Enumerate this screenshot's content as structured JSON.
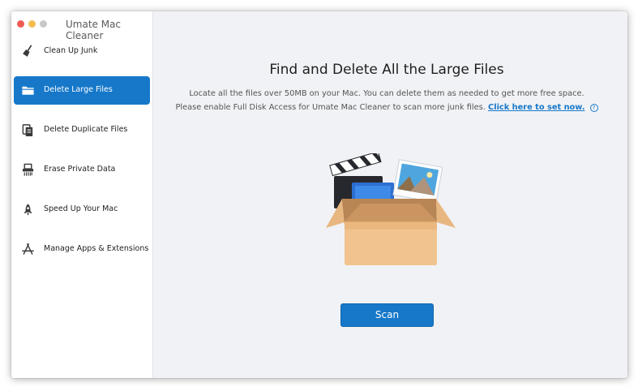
{
  "app": {
    "title": "Umate Mac Cleaner"
  },
  "sidebar": {
    "items": [
      {
        "label": "Clean Up Junk",
        "icon": "broom-icon",
        "active": false
      },
      {
        "label": "Delete Large Files",
        "icon": "folder-icon",
        "active": true
      },
      {
        "label": "Delete Duplicate Files",
        "icon": "duplicate-files-icon",
        "active": false
      },
      {
        "label": "Erase Private Data",
        "icon": "shredder-icon",
        "active": false
      },
      {
        "label": "Speed Up Your Mac",
        "icon": "rocket-icon",
        "active": false
      },
      {
        "label": "Manage Apps & Extensions",
        "icon": "app-store-icon",
        "active": false
      }
    ]
  },
  "main": {
    "title": "Find and Delete All the Large Files",
    "description_line1": "Locate all the files over 50MB on your Mac. You can delete them as needed to get more free space.",
    "description_line2": "Please enable Full Disk Access for Umate Mac Cleaner to scan more junk files.",
    "link_text": "Click here to set now.",
    "help_symbol": "?",
    "scan_label": "Scan"
  },
  "colors": {
    "accent": "#1778c9",
    "background": "#f1f2f5",
    "sidebar": "#ffffff"
  }
}
